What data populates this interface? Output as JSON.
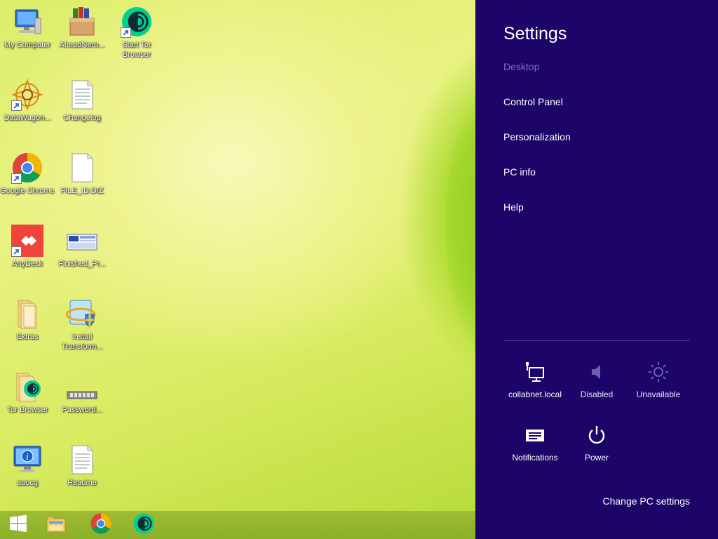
{
  "desktop": {
    "icons": [
      {
        "label": "My Computer",
        "icon": "computer-icon"
      },
      {
        "label": "AheadNero...",
        "icon": "nero-box-icon"
      },
      {
        "label": "Start Tor Browser",
        "icon": "tor-icon"
      },
      {
        "label": "DataWagon...",
        "icon": "datawagon-icon"
      },
      {
        "label": "Changelog",
        "icon": "text-file-icon"
      },
      {
        "label": "Google Chrome",
        "icon": "chrome-icon"
      },
      {
        "label": "FILE_ID.DIZ",
        "icon": "blank-file-icon"
      },
      {
        "label": "AnyDesk",
        "icon": "anydesk-icon"
      },
      {
        "label": "Finished_Pr...",
        "icon": "finished-icon"
      },
      {
        "label": "Extras",
        "icon": "folder-icon"
      },
      {
        "label": "Install Transform...",
        "icon": "installer-icon"
      },
      {
        "label": "Tor Browser",
        "icon": "tor-folder-icon"
      },
      {
        "label": "Password...",
        "icon": "password-icon"
      },
      {
        "label": "aaocg",
        "icon": "info-monitor-icon"
      },
      {
        "label": "Readme",
        "icon": "text-file-icon"
      }
    ]
  },
  "taskbar": {
    "items": [
      {
        "name": "start",
        "icon": "windows-logo-icon"
      },
      {
        "name": "file-explorer",
        "icon": "folder-icon"
      },
      {
        "name": "chrome",
        "icon": "chrome-icon"
      },
      {
        "name": "tor",
        "icon": "tor-icon"
      }
    ]
  },
  "settings": {
    "title": "Settings",
    "context": "Desktop",
    "links": [
      "Control Panel",
      "Personalization",
      "PC info",
      "Help"
    ],
    "quick": [
      {
        "label": "collabnet.local",
        "icon": "network-icon"
      },
      {
        "label": "Disabled",
        "icon": "volume-icon"
      },
      {
        "label": "Unavailable",
        "icon": "brightness-icon"
      },
      {
        "label": "Notifications",
        "icon": "notifications-icon"
      },
      {
        "label": "Power",
        "icon": "power-icon"
      }
    ],
    "change_pc": "Change PC settings",
    "colors": {
      "panel": "#1c0468",
      "context": "#7f6fc2"
    }
  }
}
